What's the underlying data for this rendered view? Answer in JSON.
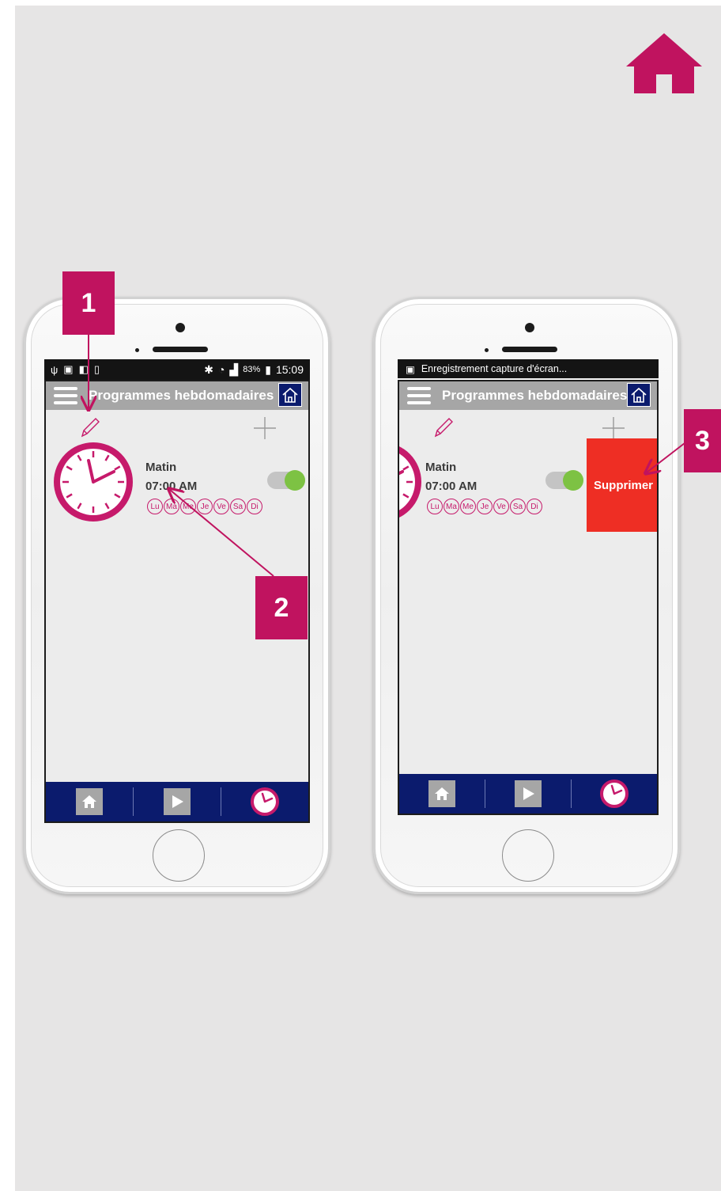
{
  "colors": {
    "panel_bg": "#e6e5e5",
    "accent_magenta": "#c0135f",
    "app_navy": "#0b1b6d",
    "app_bar_gray": "#a6a6a6",
    "toggle_green": "#7dc243",
    "delete_red": "#ee2e24"
  },
  "corner_icon": "home-icon",
  "callouts": [
    "1",
    "2",
    "3"
  ],
  "left_phone": {
    "status_bar": {
      "icons": [
        "usb-icon",
        "image-icon",
        "device-icon",
        "no-sim-icon"
      ],
      "right_icons": [
        "bluetooth-icon",
        "wifi-icon",
        "signal-icon"
      ],
      "battery": "83%",
      "time": "15:09"
    },
    "app_title": "Programmes hebdomadaires",
    "program": {
      "name": "Matin",
      "time": "07:00 AM",
      "enabled": true,
      "days": [
        "Lu",
        "Ma",
        "Me",
        "Je",
        "Ve",
        "Sa",
        "Di"
      ]
    }
  },
  "right_phone": {
    "status_bar": {
      "notification": "Enregistrement capture d'écran..."
    },
    "app_title": "Programmes hebdomadaires",
    "program": {
      "name": "Matin",
      "time": "07:00 AM",
      "enabled": true,
      "days": [
        "Lu",
        "Ma",
        "Me",
        "Je",
        "Ve",
        "Sa",
        "Di"
      ]
    },
    "delete_label": "Supprimer"
  },
  "bottom_nav": [
    "home-icon",
    "play-icon",
    "clock-icon"
  ]
}
